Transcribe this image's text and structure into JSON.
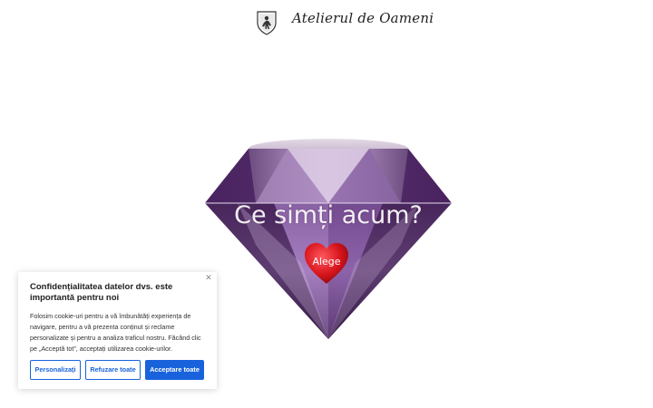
{
  "header": {
    "logo_icon": "shield-figure-icon",
    "brand_name": "Atelierul de Oameni"
  },
  "hero": {
    "image": "amethyst-diamond",
    "heading": "Ce simți acum?",
    "heart_button_label": "Alege",
    "heart_color": "#d8141c"
  },
  "cookie_banner": {
    "title": "Confidențialitatea datelor dvs. este importantă pentru noi",
    "body": "Folosim cookie-uri pentru a vă îmbunătăți experiența de navigare, pentru a vă prezenta conținut și reclame personalizate și pentru a analiza traficul nostru. Făcând clic pe „Acceptă tot”, acceptați utilizarea cookie-urilor.",
    "close_icon": "close-icon",
    "buttons": {
      "customize": "Personalizați",
      "reject": "Refuzare toate",
      "accept": "Acceptare toate"
    },
    "accent_color": "#1863dc"
  }
}
